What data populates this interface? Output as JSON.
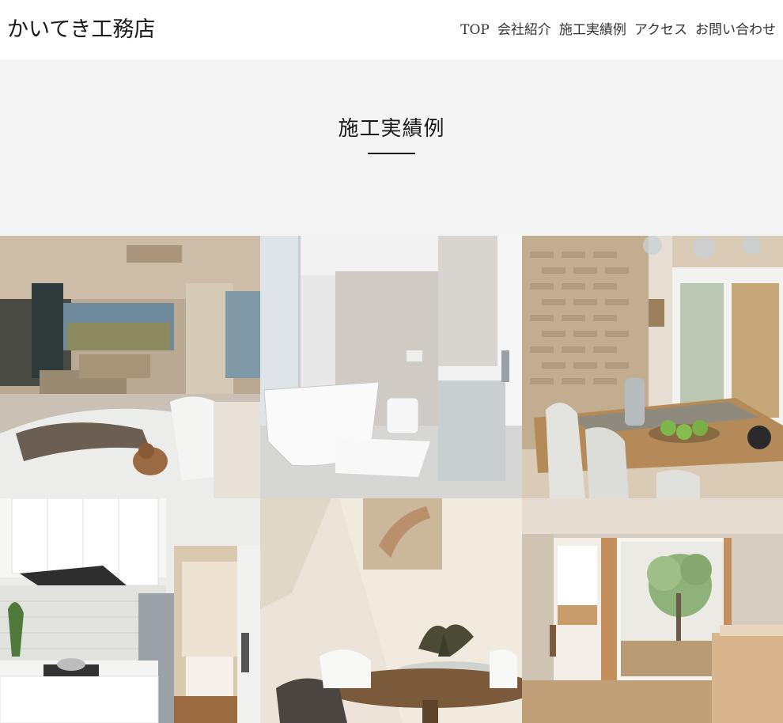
{
  "header": {
    "logo": "かいてき工務店",
    "nav": [
      {
        "label": "TOP"
      },
      {
        "label": "会社紹介"
      },
      {
        "label": "施工実績例"
      },
      {
        "label": "アクセス"
      },
      {
        "label": "お問い合わせ"
      }
    ]
  },
  "hero": {
    "title": "施工実績例"
  },
  "gallery": {
    "items": [
      {
        "subject": "living-room-with-bed-and-dog"
      },
      {
        "subject": "white-bathroom-with-tub"
      },
      {
        "subject": "dining-room-brick-wall"
      },
      {
        "subject": "white-kitchen"
      },
      {
        "subject": "dining-table-with-painting"
      },
      {
        "subject": "courtyard-hallway"
      }
    ]
  },
  "colors": {
    "hero_bg": "#f4f4f4",
    "text": "#1a1a1a",
    "background": "#ffffff"
  }
}
